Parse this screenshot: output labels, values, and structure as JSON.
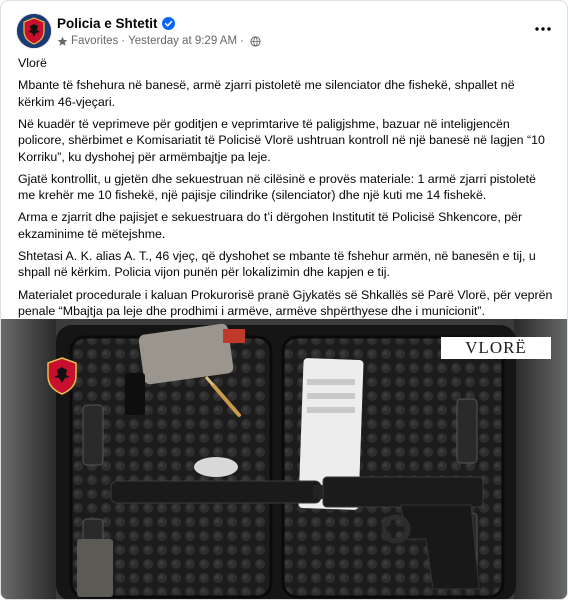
{
  "post": {
    "author": "Policia e Shtetit",
    "audience": "Favorites",
    "timestamp": "Yesterday at 9:29 AM",
    "paragraphs": [
      "Vlorë",
      "Mbante të fshehura në banesë, armë zjarri pistoletë me silenciator dhe fishekë, shpallet në kërkim 46-vjeçari.",
      "Në kuadër të veprimeve për goditjen e veprimtarive të paligjshme, bazuar në inteligjencën policore, shërbimet e Komisariatit të Policisë Vlorë ushtruan kontroll në një banesë në lagjen “10 Korriku”, ku dyshohej për armëmbajtje pa leje.",
      "Gjatë kontrollit, u gjetën dhe sekuestruan në cilësinë e provës materiale: 1 armë zjarri pistoletë me krehër me 10 fishekë, një pajisje cilindrike (silenciator) dhe një kuti me 14 fishekë.",
      "Arma e zjarrit dhe pajisjet e sekuestruara do t’i dërgohen Institutit të Policisë Shkencore, për ekzaminime të mëtejshme.",
      "Shtetasi A. K. alias A. T., 46 vjeç, që dyshohet se mbante të fshehur armën, në banesën e tij, u shpall në kërkim. Policia vijon punën për lokalizimin dhe kapjen e tij.",
      "Materialet procedurale i kaluan Prokurorisë pranë Gjykatës së Shkallës së Parë Vlorë, për veprën penale “Mbajtja pa leje dhe prodhimi i armëve, armëve shpërthyese dhe i municionit”."
    ],
    "photo_caption": "VLORË"
  },
  "icons": {
    "verified": "verified-badge-icon",
    "audience": "star-icon",
    "privacy": "globe-icon",
    "more": "more-options-icon"
  },
  "colors": {
    "verified_blue": "#0866ff",
    "meta_gray": "#65676b",
    "text": "#050505"
  }
}
